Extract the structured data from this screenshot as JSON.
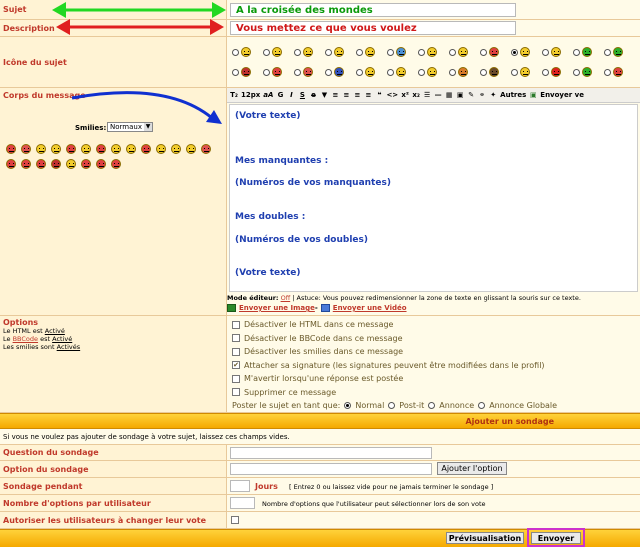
{
  "subject": {
    "label": "Sujet",
    "value": "A la croisée des mondes"
  },
  "description": {
    "label": "Description",
    "value": "Vous mettez ce que vous voulez"
  },
  "icon_section": {
    "label": "Icône du sujet"
  },
  "body": {
    "label": "Corps du message",
    "smilies_label": "Smilies:",
    "smilies_select": "Normaux",
    "lines": [
      "(Votre texte)",
      "Mes manquantes :",
      "(Numéros de vos manquantes)",
      "Mes doubles :",
      "(Numéros de vos doubles)",
      "(Votre texte)"
    ]
  },
  "toolbar": {
    "font_size": "12px",
    "others": "Autres",
    "send_to": "Envoyer ve"
  },
  "editor_mode": {
    "prefix": "Mode éditeur:",
    "mode": "Off",
    "hint": "| Astuce: Vous pouvez redimensionner la zone de texte en glissant la souris sur ce texte."
  },
  "upload": {
    "image": "Envoyer une Image",
    "sep": " - ",
    "video": "Envoyer une Vidéo"
  },
  "options": {
    "title": "Options",
    "html": "Le HTML est",
    "html_val": "Activé",
    "bb_pre": "Le",
    "bbcode": "BBCode",
    "bb_mid": "est",
    "bb_val": "Activé",
    "smilies": "Les smilies sont",
    "smilies_val": "Activés",
    "checks": [
      "Désactiver le HTML dans ce message",
      "Désactiver le BBCode dans ce message",
      "Désactiver les smilies dans ce message",
      "Attacher sa signature (les signatures peuvent être modifiées dans le profil)",
      "M'avertir lorsqu'une réponse est postée",
      "Supprimer ce message"
    ],
    "post_as": "Poster le sujet en tant que:",
    "post_types": [
      "Normal",
      "Post-it",
      "Annonce",
      "Annonce Globale"
    ]
  },
  "poll": {
    "header": "Ajouter un sondage",
    "intro": "Si vous ne voulez pas ajouter de sondage à votre sujet, laissez ces champs vides.",
    "question": "Question du sondage",
    "option": "Option du sondage",
    "add_option": "Ajouter l'option",
    "duration": "Sondage pendant",
    "days": "Jours",
    "duration_hint": "[ Entrez 0 ou laissez vide pour ne jamais terminer le sondage ]",
    "per_user": "Nombre d'options par utilisateur",
    "per_user_hint": "Nombre d'options que l'utilisateur peut sélectionner lors de son vote",
    "allow_change": "Autoriser les utilisateurs à changer leur vote"
  },
  "actions": {
    "preview": "Prévisualisation",
    "send": "Envoyer"
  },
  "colors": {
    "accent": "#c0392b",
    "arrow_green": "#22d822",
    "arrow_red": "#e02020",
    "arrow_blue": "#1030d0",
    "highlight": "#cc33cc",
    "poll_bar": "#f5a800"
  }
}
